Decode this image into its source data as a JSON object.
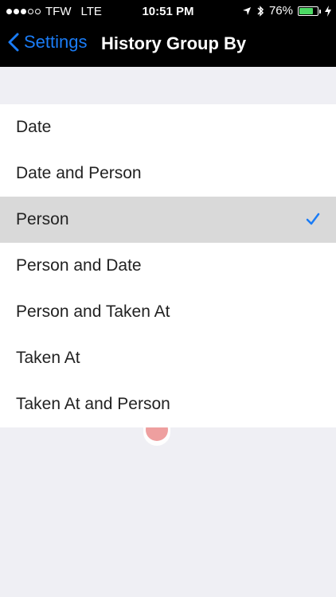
{
  "status_bar": {
    "carrier": "TFW",
    "network": "LTE",
    "time": "10:51 PM",
    "battery_percent": "76%",
    "battery_level": 0.76,
    "signal_bars_filled": 3,
    "signal_bars_total": 5
  },
  "nav": {
    "back_label": "Settings",
    "title": "History Group By"
  },
  "options": [
    {
      "label": "Date",
      "selected": false
    },
    {
      "label": "Date and Person",
      "selected": false
    },
    {
      "label": "Person",
      "selected": true
    },
    {
      "label": "Person and Date",
      "selected": false
    },
    {
      "label": "Person and Taken At",
      "selected": false
    },
    {
      "label": "Taken At",
      "selected": false
    },
    {
      "label": "Taken At and Person",
      "selected": false
    }
  ],
  "colors": {
    "accent": "#1a7cf6",
    "battery": "#4cd964",
    "selected_row": "#d9d9d9",
    "background": "#efeff4"
  },
  "icons": {
    "back": "chevron-left-icon",
    "check": "checkmark-icon",
    "location": "location-arrow-icon",
    "bluetooth": "bluetooth-icon",
    "charging": "lightning-icon"
  }
}
